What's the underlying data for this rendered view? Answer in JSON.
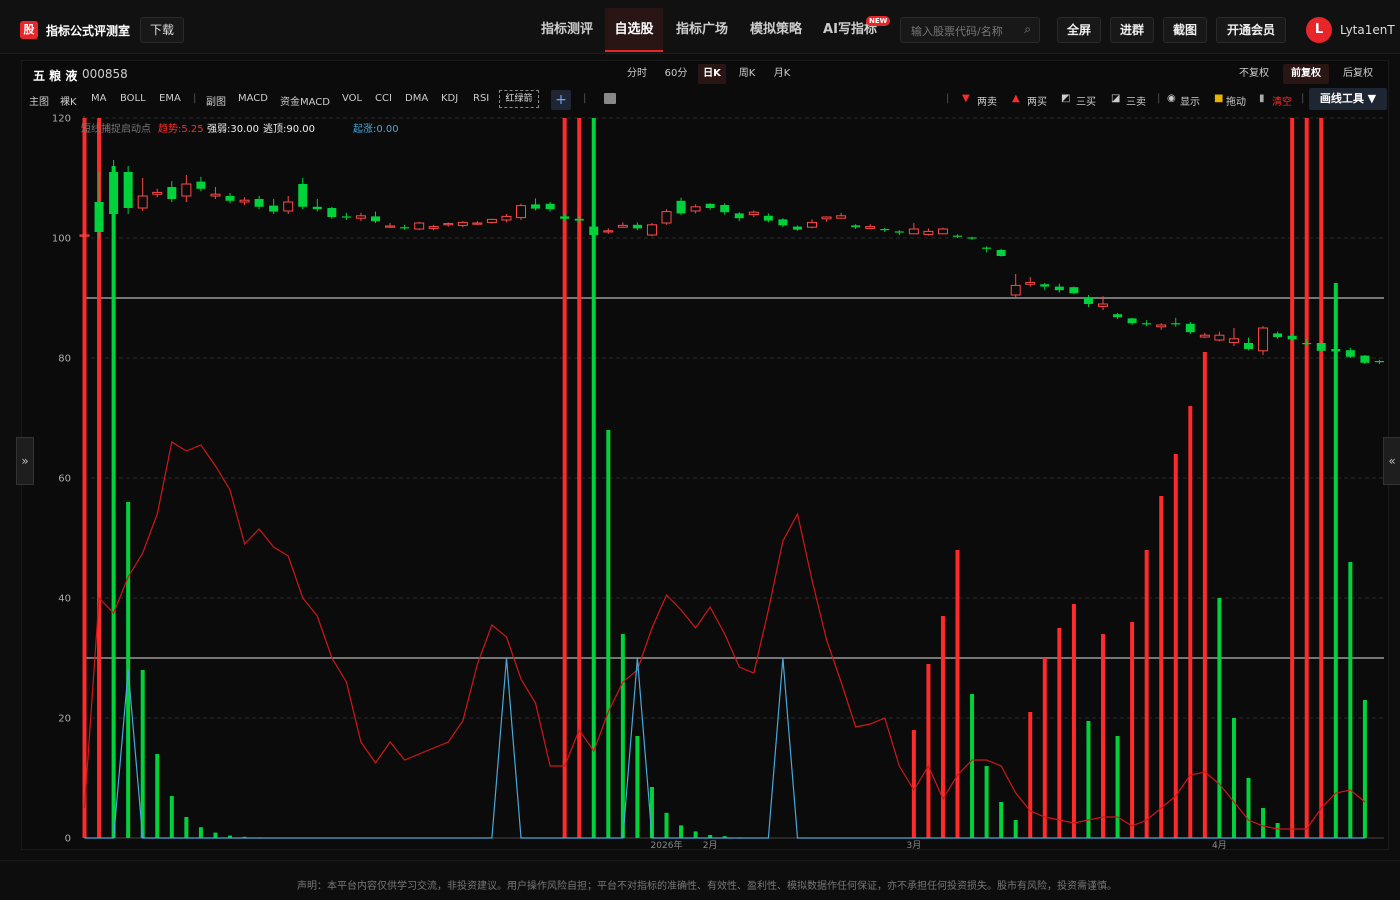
{
  "header": {
    "logo": "股",
    "title": "指标公式评测室",
    "download": "下载",
    "nav": [
      "指标测评",
      "自选股",
      "指标广场",
      "模拟策略",
      "AI写指标"
    ],
    "new_badge": "NEW",
    "search_placeholder": "输入股票代码/名称",
    "buttons": [
      "全屏",
      "进群",
      "截图",
      "开通会员"
    ],
    "avatar_letter": "L",
    "username": "Lyta1enT"
  },
  "stock": {
    "name": "五 粮 液",
    "code": "000858"
  },
  "periods": [
    "分时",
    "60分",
    "日K",
    "周K",
    "月K"
  ],
  "active_period": "日K",
  "adjust": [
    "不复权",
    "前复权",
    "后复权"
  ],
  "active_adjust": "前复权",
  "indicators": [
    "主图",
    "裸K",
    "MA",
    "BOLL",
    "EMA",
    "副图",
    "MACD",
    "资金MACD",
    "VOL",
    "CCI",
    "DMA",
    "KDJ",
    "RSI"
  ],
  "red_green": "红绿箭",
  "add": "+",
  "tools": [
    "两卖",
    "两买",
    "三买",
    "三卖",
    "显示",
    "拖动",
    "清空"
  ],
  "draw_tools": "画线工具 ▼",
  "legend": {
    "name": "短线捕捉启动点",
    "trend": "趋势:5.25",
    "strong": "强弱:30.00",
    "top": "逃顶:90.00",
    "rise": "起涨:0.00"
  },
  "footer": "声明：本平台内容仅供学习交流，非投资建议。用户操作风险自担；平台不对指标的准确性、有效性、盈利性、模拟数据作任何保证，亦不承担任何投资损失。股市有风险，投资需谨慎。",
  "colors": {
    "accent": "#e8262a",
    "up": "#ff2a2a",
    "down": "#00d23c",
    "trend": "#d01818",
    "rise": "#4aa8d8"
  },
  "chart_data": {
    "type": "candlestick+bar+line",
    "ylim": [
      0,
      120
    ],
    "yticks": [
      0,
      20,
      40,
      60,
      80,
      100,
      120
    ],
    "ref_lines": [
      90,
      30
    ],
    "x_labels": [
      {
        "i": 40,
        "label": "2026年"
      },
      {
        "i": 43,
        "label": "2月"
      },
      {
        "i": 57,
        "label": "3月"
      },
      {
        "i": 78,
        "label": "4月"
      }
    ],
    "candles": [
      [
        100.5,
        100.5,
        100.7,
        100.3
      ],
      [
        106,
        101,
        111,
        100
      ],
      [
        111,
        104,
        113,
        103
      ],
      [
        111,
        105,
        112,
        104
      ],
      [
        105,
        107,
        110,
        104.5
      ],
      [
        107.3,
        107.6,
        108.2,
        106.8
      ],
      [
        108.5,
        106.5,
        109.5,
        106
      ],
      [
        107,
        109,
        110.5,
        106
      ],
      [
        109.4,
        108.2,
        110.2,
        107.8
      ],
      [
        107,
        107.3,
        108.5,
        106.5
      ],
      [
        107,
        106.2,
        107.5,
        105.8
      ],
      [
        106,
        106.3,
        106.8,
        105.5
      ],
      [
        106.5,
        105.2,
        107,
        104.8
      ],
      [
        105.4,
        104.4,
        106.5,
        104
      ],
      [
        104.5,
        106,
        107,
        104
      ],
      [
        109,
        105.2,
        110,
        104.8
      ],
      [
        105.2,
        104.8,
        106.5,
        104.4
      ],
      [
        105,
        103.5,
        105.2,
        103.2
      ],
      [
        103.6,
        103.4,
        104.2,
        103
      ],
      [
        103.3,
        103.7,
        104.2,
        102.8
      ],
      [
        103.6,
        102.8,
        104.4,
        102.5
      ],
      [
        102,
        102,
        102.5,
        101.7
      ],
      [
        101.8,
        101.7,
        102.2,
        101.4
      ],
      [
        101.5,
        102.5,
        102.7,
        101.3
      ],
      [
        101.6,
        101.9,
        102.2,
        101.3
      ],
      [
        102.2,
        102.4,
        102.6,
        101.9
      ],
      [
        102.1,
        102.6,
        102.8,
        101.8
      ],
      [
        102.4,
        102.5,
        102.8,
        102.2
      ],
      [
        102.6,
        103.1,
        103.2,
        102.4
      ],
      [
        103,
        103.6,
        104,
        102.6
      ],
      [
        103.4,
        105.4,
        105.7,
        103
      ],
      [
        105.6,
        104.9,
        106.6,
        104.6
      ],
      [
        105.7,
        104.8,
        106,
        104.4
      ],
      [
        103.6,
        103.2,
        104,
        102.8
      ],
      [
        103.2,
        102.9,
        103.7,
        102.5
      ],
      [
        101.9,
        100.5,
        102.1,
        100
      ],
      [
        101,
        101.2,
        101.6,
        100.7
      ],
      [
        101.8,
        102.1,
        102.6,
        101.7
      ],
      [
        102.2,
        101.6,
        102.6,
        101.3
      ],
      [
        100.5,
        102.2,
        102.5,
        100.3
      ],
      [
        102.5,
        104.4,
        104.8,
        102.2
      ],
      [
        106.2,
        104.1,
        106.7,
        103.8
      ],
      [
        104.5,
        105.2,
        105.6,
        104.1
      ],
      [
        105.7,
        105,
        105.8,
        104.7
      ],
      [
        105.5,
        104.3,
        105.8,
        103.9
      ],
      [
        104.1,
        103.3,
        104.3,
        102.8
      ],
      [
        103.9,
        104.3,
        104.6,
        103.5
      ],
      [
        103.7,
        102.9,
        104.1,
        102.6
      ],
      [
        103.1,
        102.1,
        103.3,
        101.8
      ],
      [
        101.9,
        101.4,
        102.1,
        101.2
      ],
      [
        101.8,
        102.6,
        103.1,
        101.6
      ],
      [
        103.2,
        103.5,
        103.6,
        102.7
      ],
      [
        103.3,
        103.7,
        104.2,
        103.3
      ],
      [
        102.1,
        101.8,
        102.3,
        101.5
      ],
      [
        101.6,
        101.9,
        102.3,
        101.5
      ],
      [
        101.5,
        101.3,
        101.7,
        101
      ],
      [
        101.1,
        100.9,
        101.3,
        100.5
      ],
      [
        100.7,
        101.5,
        102.5,
        100.6
      ],
      [
        100.6,
        101.1,
        101.6,
        100.4
      ],
      [
        100.7,
        101.5,
        101.7,
        100.6
      ],
      [
        100.4,
        100.2,
        100.6,
        100
      ],
      [
        100.1,
        100,
        100.2,
        99.7
      ],
      [
        98.4,
        98.3,
        98.6,
        97.6
      ],
      [
        98,
        97,
        98.2,
        96.9
      ],
      [
        90.5,
        92.1,
        94,
        90
      ],
      [
        92.3,
        92.6,
        93.5,
        91.9
      ],
      [
        92.3,
        91.9,
        92.5,
        91.3
      ],
      [
        91.9,
        91.3,
        92.4,
        90.9
      ],
      [
        91.8,
        90.8,
        91.9,
        90.6
      ],
      [
        90,
        89,
        90.5,
        88.5
      ],
      [
        88.6,
        89,
        90.3,
        88
      ],
      [
        87.3,
        86.8,
        87.5,
        86.5
      ],
      [
        86.6,
        85.8,
        86.7,
        85.5
      ],
      [
        85.8,
        85.6,
        86.3,
        85.3
      ],
      [
        85.2,
        85.5,
        85.8,
        84.7
      ],
      [
        85.8,
        85.6,
        86.7,
        85.2
      ],
      [
        85.7,
        84.3,
        86,
        84
      ],
      [
        83.5,
        83.8,
        84.2,
        83.3
      ],
      [
        83,
        83.8,
        84.4,
        82.8
      ],
      [
        82.6,
        83.2,
        85,
        82
      ],
      [
        82.5,
        81.5,
        83.4,
        81.3
      ],
      [
        81.2,
        85,
        85.3,
        80.5
      ],
      [
        84.1,
        83.5,
        84.4,
        83.2
      ],
      [
        83.7,
        83.1,
        84,
        82.8
      ],
      [
        82.5,
        82.4,
        83.2,
        82.1
      ],
      [
        82.5,
        81.2,
        82.9,
        81
      ],
      [
        81.5,
        81.1,
        81.9,
        80.6
      ],
      [
        81.3,
        80.2,
        81.7,
        80
      ],
      [
        80.4,
        79.2,
        80.5,
        79
      ],
      [
        79.5,
        79.3,
        79.7,
        79
      ],
      [
        79.4,
        79.4,
        79.4,
        79.4
      ],
      [
        79.5,
        79.5,
        80,
        79.1
      ],
      [
        80,
        79.7,
        80.3,
        79.5
      ],
      [
        79.9,
        79.5,
        80.3,
        79.2
      ],
      [
        79.3,
        78.3,
        79.7,
        78
      ]
    ],
    "bars": [
      [
        0,
        120,
        "r"
      ],
      [
        1,
        120,
        "r"
      ],
      [
        2,
        112,
        "g"
      ],
      [
        3,
        56,
        "g"
      ],
      [
        4,
        28,
        "g"
      ],
      [
        5,
        14,
        "g"
      ],
      [
        6,
        7,
        "g"
      ],
      [
        7,
        3.5,
        "g"
      ],
      [
        8,
        1.8,
        "g"
      ],
      [
        9,
        0.9,
        "g"
      ],
      [
        10,
        0.4,
        "g"
      ],
      [
        11,
        0.2,
        "g"
      ],
      [
        12,
        0.1,
        "g"
      ],
      [
        33,
        120,
        "r"
      ],
      [
        34,
        120,
        "r"
      ],
      [
        35,
        120,
        "g"
      ],
      [
        36,
        68,
        "g"
      ],
      [
        37,
        34,
        "g"
      ],
      [
        38,
        17,
        "g"
      ],
      [
        39,
        8.5,
        "g"
      ],
      [
        40,
        4.2,
        "g"
      ],
      [
        41,
        2.1,
        "g"
      ],
      [
        42,
        1.1,
        "g"
      ],
      [
        43,
        0.5,
        "g"
      ],
      [
        44,
        0.3,
        "g"
      ],
      [
        45,
        0.1,
        "g"
      ],
      [
        57,
        18,
        "r"
      ],
      [
        58,
        29,
        "r"
      ],
      [
        59,
        37,
        "r"
      ],
      [
        60,
        48,
        "r"
      ],
      [
        61,
        24,
        "g"
      ],
      [
        62,
        12,
        "g"
      ],
      [
        63,
        6,
        "g"
      ],
      [
        64,
        3,
        "g"
      ],
      [
        65,
        21,
        "r"
      ],
      [
        66,
        30,
        "r"
      ],
      [
        67,
        35,
        "r"
      ],
      [
        68,
        39,
        "r"
      ],
      [
        69,
        19.5,
        "g"
      ],
      [
        70,
        34,
        "r"
      ],
      [
        71,
        17,
        "g"
      ],
      [
        72,
        36,
        "r"
      ],
      [
        73,
        48,
        "r"
      ],
      [
        74,
        57,
        "r"
      ],
      [
        75,
        64,
        "r"
      ],
      [
        76,
        72,
        "r"
      ],
      [
        77,
        81,
        "r"
      ],
      [
        78,
        40,
        "g"
      ],
      [
        79,
        20,
        "g"
      ],
      [
        80,
        10,
        "g"
      ],
      [
        81,
        5,
        "g"
      ],
      [
        82,
        2.5,
        "g"
      ],
      [
        83,
        120,
        "r"
      ],
      [
        84,
        120,
        "r"
      ],
      [
        85,
        120,
        "r"
      ],
      [
        86,
        92.5,
        "g"
      ],
      [
        87,
        46,
        "g"
      ],
      [
        88,
        23,
        "g"
      ]
    ],
    "trend": [
      5,
      40,
      37.5,
      43.5,
      47.5,
      54,
      66,
      64.5,
      65.5,
      62,
      58,
      49,
      51.5,
      48.5,
      47,
      40,
      37,
      30,
      26,
      16,
      12.5,
      16,
      13,
      14,
      15,
      16,
      19.5,
      29,
      35.5,
      33.5,
      26.5,
      22.5,
      12,
      12,
      18,
      14.5,
      21,
      26,
      28,
      35,
      40.5,
      38,
      35,
      38.5,
      34,
      28.5,
      27.5,
      38,
      49.5,
      54,
      43,
      33,
      26,
      18.5,
      19,
      20,
      12,
      8,
      12,
      6.5,
      10.5,
      13,
      13,
      12,
      7.5,
      4.5,
      3.5,
      3,
      2.5,
      3,
      3.5,
      3.5,
      2,
      3,
      5,
      7,
      10.5,
      11,
      9,
      6,
      3,
      2,
      1.5,
      1.5,
      1.5,
      5,
      7.5,
      8,
      6
    ],
    "rise": [
      [
        0,
        0
      ],
      [
        2,
        0
      ],
      [
        3,
        28
      ],
      [
        4,
        0
      ],
      [
        28,
        0
      ],
      [
        29,
        30
      ],
      [
        30,
        0
      ],
      [
        37,
        0
      ],
      [
        38,
        30
      ],
      [
        39,
        0
      ],
      [
        47,
        0
      ],
      [
        48,
        30
      ],
      [
        49,
        0
      ],
      [
        88,
        0
      ]
    ]
  }
}
